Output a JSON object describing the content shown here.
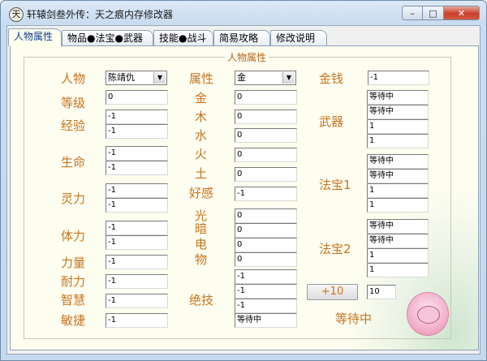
{
  "window": {
    "title": "轩辕剑叁外传：天之痕内存修改器",
    "min": "–",
    "max": "□",
    "close": "✕"
  },
  "tabs": [
    "人物属性",
    "物品●法宝●武器",
    "技能●战斗",
    "简易攻略",
    "修改说明"
  ],
  "group_title": "人物属性",
  "col1": {
    "person_label": "人物",
    "person_value": "陈靖仇",
    "level_label": "等级",
    "level_value": "0",
    "exp_label": "经验",
    "exp_values": [
      "-1",
      "-1"
    ],
    "hp_label": "生命",
    "hp_values": [
      "-1",
      "-1"
    ],
    "mp_label": "灵力",
    "mp_values": [
      "-1",
      "-1"
    ],
    "stamina_label": "体力",
    "stamina_values": [
      "-1",
      "-1"
    ],
    "strength_label": "力量",
    "strength_value": "-1",
    "endurance_label": "耐力",
    "endurance_value": "-1",
    "wisdom_label": "智慧",
    "wisdom_value": "-1",
    "agility_label": "敏捷",
    "agility_value": "-1"
  },
  "col2": {
    "attr_label": "属性",
    "attr_value": "金",
    "metal_label": "金",
    "metal_value": "0",
    "wood_label": "木",
    "wood_value": "0",
    "water_label": "水",
    "water_value": "0",
    "fire_label": "火",
    "fire_value": "0",
    "earth_label": "土",
    "earth_value": "0",
    "favor_label": "好感",
    "favor_value": "-1",
    "light_label": "光",
    "dark_label": "暗",
    "elec_label": "电",
    "thing_label": "物",
    "light_values": [
      "0",
      "0",
      "0",
      "0"
    ],
    "skill_label": "绝技",
    "skill_values": [
      "-1",
      "-1",
      "-1",
      "等待中"
    ]
  },
  "col3": {
    "money_label": "金钱",
    "money_value": "-1",
    "weapon_label": "武器",
    "weapon_values": [
      "等待中",
      "等待中",
      "1",
      "1"
    ],
    "fabao1_label": "法宝1",
    "fabao1_values": [
      "等待中",
      "等待中",
      "1",
      "1"
    ],
    "fabao2_label": "法宝2",
    "fabao2_values": [
      "等待中",
      "等待中",
      "1",
      "1"
    ],
    "plus_label": "+10",
    "plus_value": "10",
    "status_text": "等待中"
  },
  "colors": {
    "label": "#c8741e",
    "panel": "#fdfdf0",
    "close": "#c9402b"
  }
}
